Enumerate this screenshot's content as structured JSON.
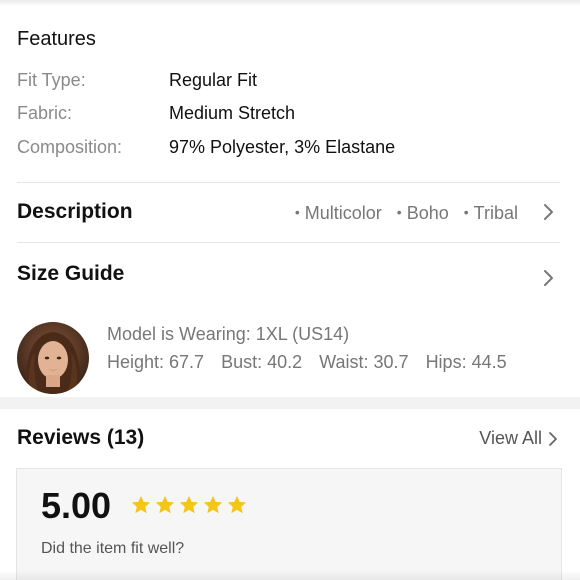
{
  "features": {
    "title": "Features",
    "rows": [
      {
        "label": "Fit Type:",
        "value": "Regular Fit"
      },
      {
        "label": "Fabric:",
        "value": "Medium Stretch"
      },
      {
        "label": "Composition:",
        "value": "97% Polyester, 3% Elastane"
      }
    ]
  },
  "description": {
    "title": "Description",
    "tags": [
      "Multicolor",
      "Boho",
      "Tribal"
    ],
    "chevron_icon": "chevron-right-icon"
  },
  "size_guide": {
    "title": "Size Guide",
    "chevron_icon": "chevron-right-icon",
    "model_wearing": "Model is Wearing: 1XL (US14)",
    "measurements": [
      "Height: 67.7",
      "Bust: 40.2",
      "Waist: 30.7",
      "Hips: 44.5"
    ]
  },
  "reviews": {
    "title": "Reviews (13)",
    "view_all_label": "View All",
    "rating": "5.00",
    "stars": 5,
    "star_color": "#f5c518",
    "fit_question": "Did the item fit well?"
  }
}
